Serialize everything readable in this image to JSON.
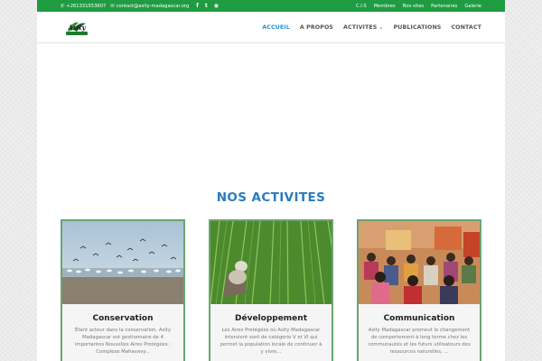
{
  "topbar": {
    "phone": "+261331553607",
    "email": "contact@asity-madagascar.org",
    "links": [
      "C.I.S",
      "Membres",
      "Nos sites",
      "Partenaires",
      "Galerie"
    ]
  },
  "logo": {
    "text": "Asity"
  },
  "nav": {
    "items": [
      "ACCUEIL",
      "A PROPOS",
      "ACTIVITES",
      "PUBLICATIONS",
      "CONTACT"
    ]
  },
  "section": {
    "title": "NOS ACTIVITES"
  },
  "cards": [
    {
      "title": "Conservation",
      "text": "Étant acteur dans la conservation, Asity Madagascar est gestionnaire de 4 importantes Nouvelles Aires Protégées : Complexe Mahavavy..."
    },
    {
      "title": "Développement",
      "text": "Les Aires Protégées où Asity Madagascar intervient sont de catégorie V et VI qui permet la population locale de continuer à y vivre..."
    },
    {
      "title": "Communication",
      "text": "Asity Madagascar promeut le changement de comportement à long terme chez les communautés et les futurs utilisateurs des ressources naturelles, ..."
    }
  ],
  "colors": {
    "topbar": "#1f9c42",
    "accent": "#2a8fd1",
    "section_title": "#2a7bc0",
    "card_border": "#6aa56f"
  }
}
